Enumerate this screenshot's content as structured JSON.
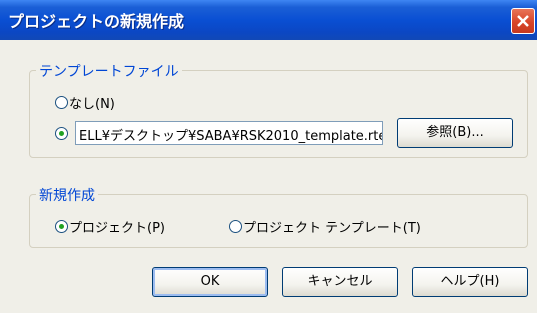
{
  "dialog": {
    "title": "プロジェクトの新規作成"
  },
  "template_file_group": {
    "legend": "テンプレートファイル",
    "option_none_label": "なし(N)",
    "option_none_selected": false,
    "option_file_selected": true,
    "file_path_value": "ELL¥デスクトップ¥SABA¥RSK2010_template.rte",
    "browse_label": "参照(B)..."
  },
  "new_create_group": {
    "legend": "新規作成",
    "option_project_label": "プロジェクト(P)",
    "option_project_selected": true,
    "option_project_template_label": "プロジェクト テンプレート(T)",
    "option_project_template_selected": false
  },
  "buttons": {
    "ok_label": "OK",
    "cancel_label": "キャンセル",
    "help_label": "ヘルプ(H)"
  },
  "colors": {
    "titlebar": "#0a4fd3",
    "legend_text": "#0046d5",
    "dialog_bg": "#f0efe8",
    "close_button": "#d8452a",
    "radio_dot": "#21a121"
  }
}
